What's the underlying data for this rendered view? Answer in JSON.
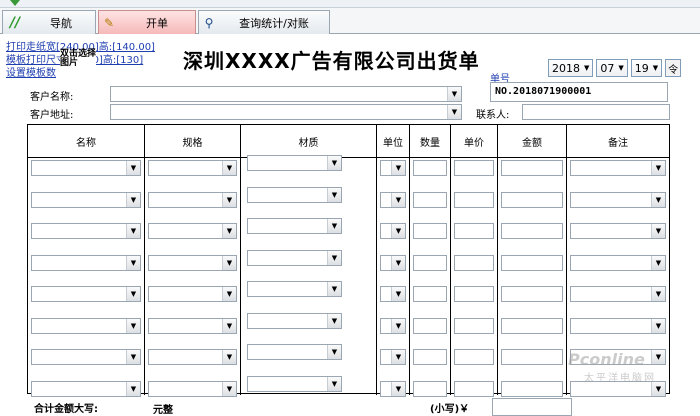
{
  "tabs": [
    {
      "label": "导航",
      "icon": "//"
    },
    {
      "label": "开单",
      "icon": "✎"
    },
    {
      "label": "查询统计/对账",
      "icon": "⚲"
    }
  ],
  "links": [
    "打印走纸宽[240.00]高:[140.00]",
    "模板打印尺寸宽[210]高:[130]",
    "设置模板数"
  ],
  "overlay_text": "双击选择图片",
  "title": "深圳XXXX广告有限公司出货单",
  "date": {
    "year": "2018",
    "month": "07",
    "day": "19"
  },
  "doc_label": "单号",
  "doc_no": "NO.2018071900001",
  "customer_name_label": "客户名称:",
  "customer_addr_label": "客户地址:",
  "contact_label": "联系人:",
  "table": {
    "columns": [
      "名称",
      "规格",
      "材质",
      "单位",
      "数量",
      "单价",
      "金额",
      "备注"
    ],
    "row_count": 8
  },
  "total_label": "合计金额大写:",
  "total_unit": "元整",
  "small_label": "(小写)￥",
  "watermark": "Pconline",
  "watermark2": "太平洋电脑网"
}
